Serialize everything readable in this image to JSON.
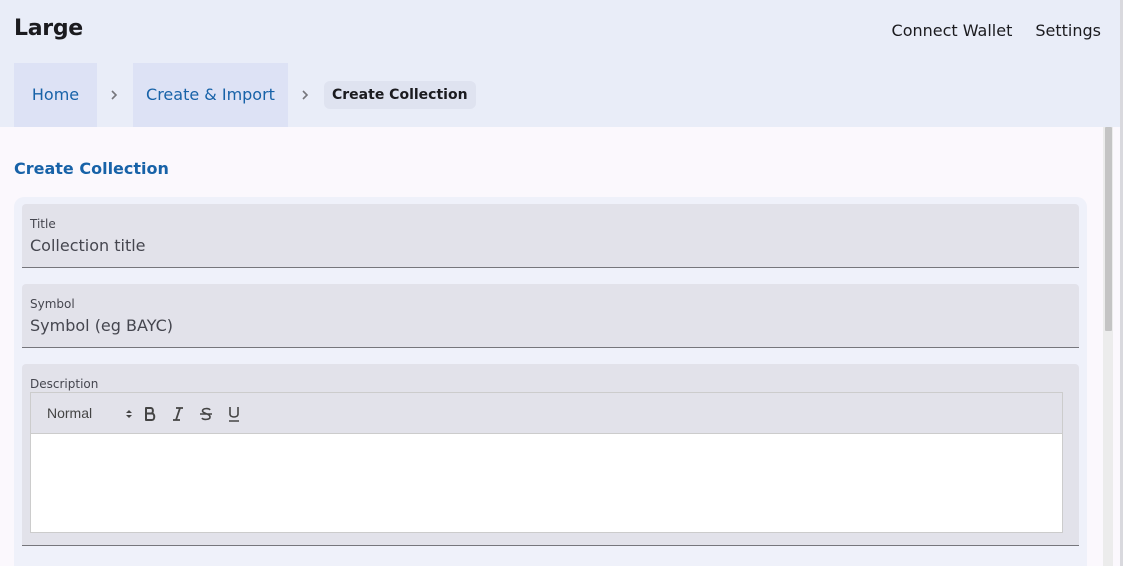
{
  "header": {
    "app_title": "Large",
    "links": {
      "connect_wallet": "Connect Wallet",
      "settings": "Settings"
    }
  },
  "breadcrumb": {
    "items": [
      {
        "label": "Home"
      },
      {
        "label": "Create & Import"
      }
    ],
    "current": "Create Collection",
    "separator_icon": "chevron-right-icon"
  },
  "page": {
    "title": "Create Collection"
  },
  "form": {
    "title_field": {
      "label": "Title",
      "placeholder": "Collection title",
      "value": ""
    },
    "symbol_field": {
      "label": "Symbol",
      "placeholder": "Symbol (eg BAYC)",
      "value": ""
    },
    "description_field": {
      "label": "Description",
      "toolbar": {
        "format": "Normal",
        "buttons": [
          "bold-icon",
          "italic-icon",
          "strikethrough-icon",
          "underline-icon"
        ]
      },
      "value": ""
    }
  },
  "colors": {
    "primary": "#1762a8",
    "header_bg": "#e9edf8",
    "breadcrumb_item_bg": "#dde2f5",
    "field_bg": "#e2e2ea",
    "page_bg": "#fbf8fd"
  }
}
